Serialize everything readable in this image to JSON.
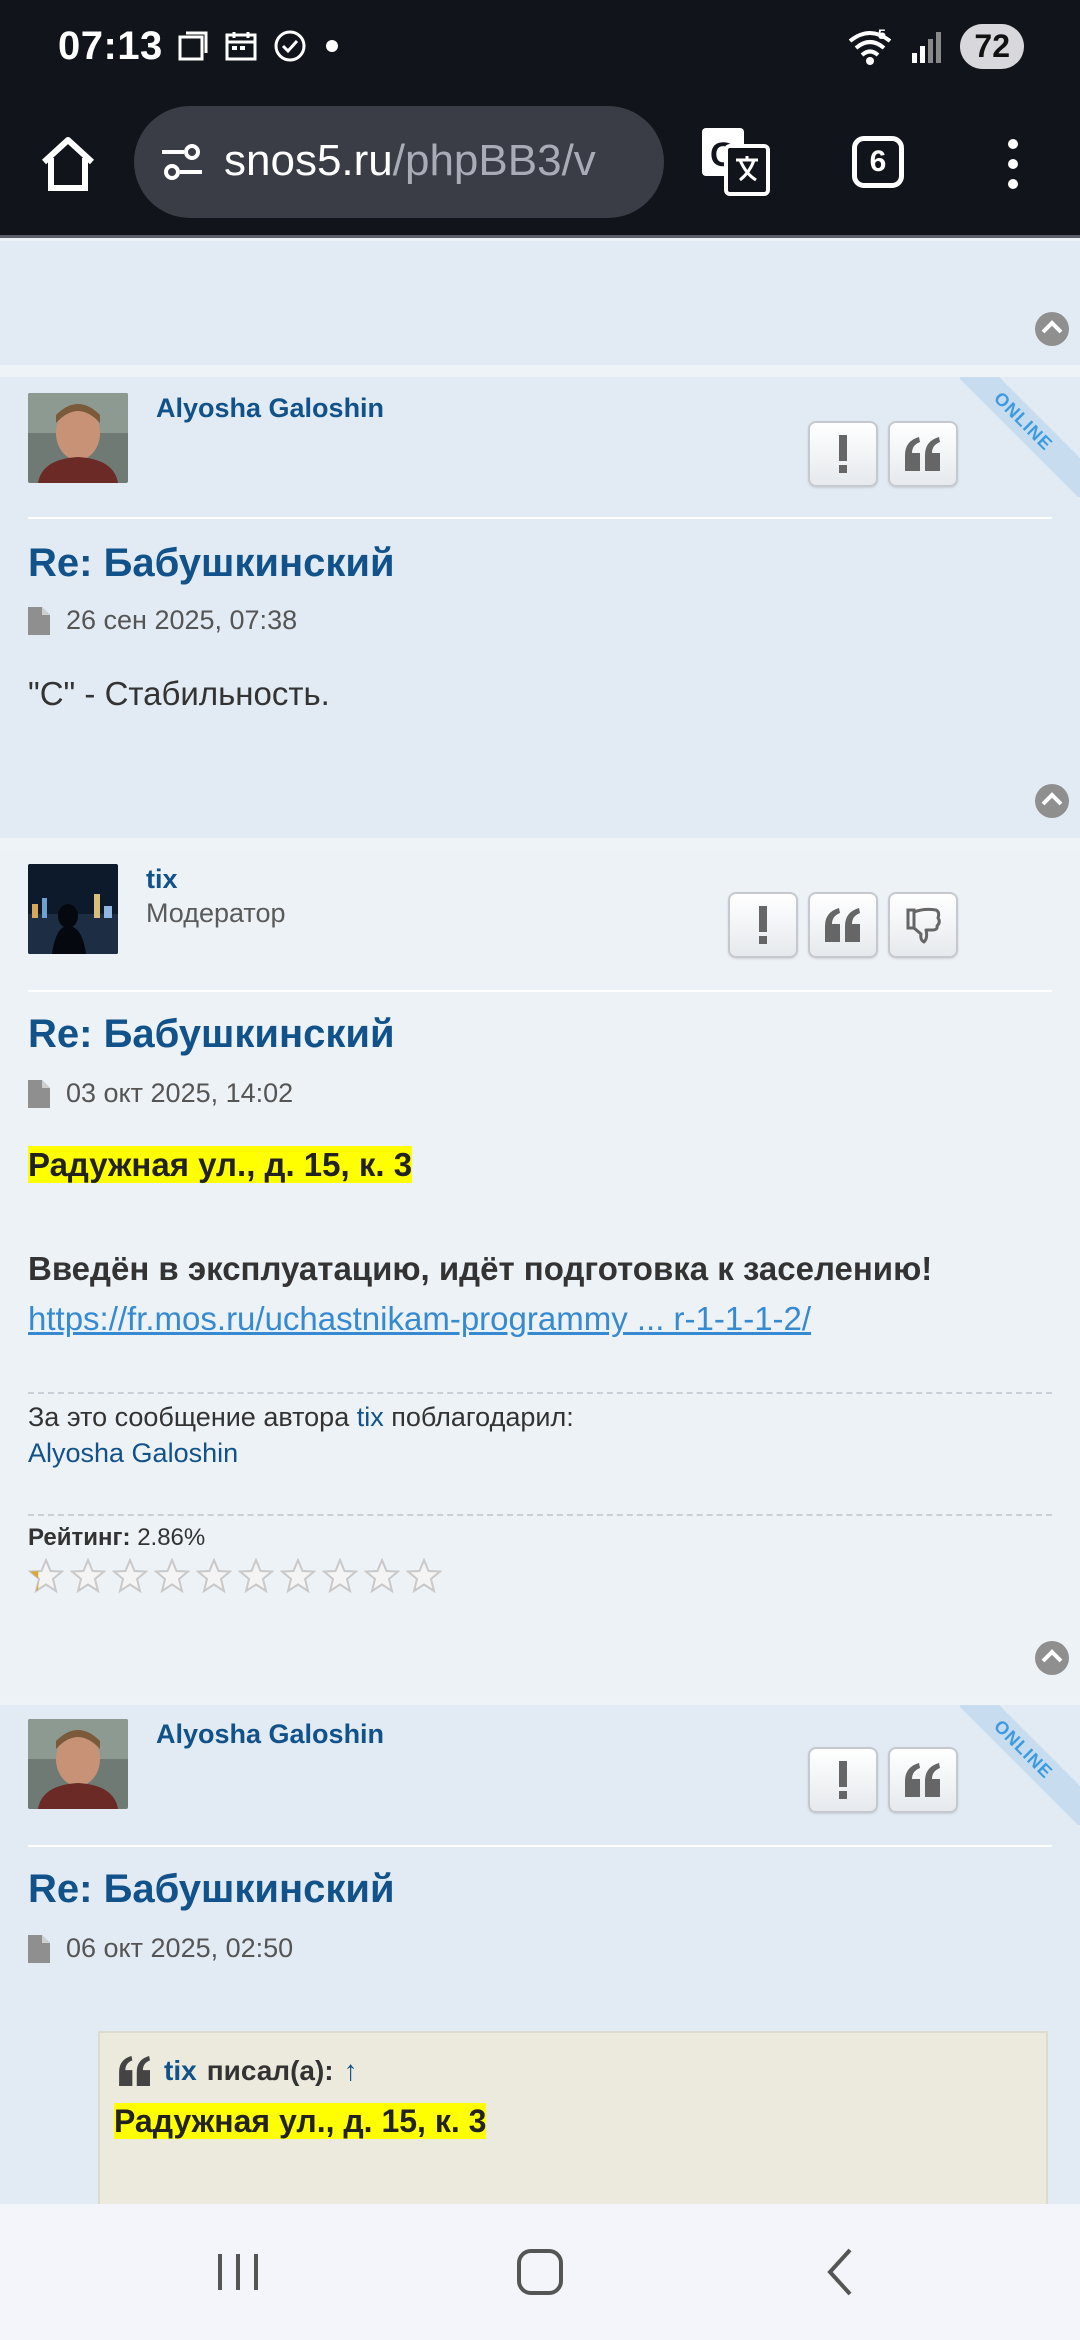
{
  "status_bar": {
    "time": "07:13",
    "wifi_badge": "5",
    "battery": "72"
  },
  "browser": {
    "url_host": "snos5.ru",
    "url_path": "/phpBB3/v",
    "tab_count": "6"
  },
  "posts": [
    {
      "author": "Alyosha Galoshin",
      "online_label": "ONLINE",
      "title": "Re: Бабушкинский",
      "date": "26 сен 2025, 07:38",
      "body": "\"С\" - Стабильность."
    },
    {
      "author": "tix",
      "rank": "Модератор",
      "title": "Re: Бабушкинский",
      "date": "03 окт 2025, 14:02",
      "highlight": "Радужная ул., д. 15, к. 3",
      "body_bold": "Введён в эксплуатацию, идёт подготовка к заселению!",
      "link": "https://fr.mos.ru/uchastnikam-programmy ... r-1-1-1-2/",
      "thanks_prefix": "За это сообщение автора",
      "thanks_author": "tix",
      "thanks_suffix": "поблагодарил:",
      "thanks_user": "Alyosha Galoshin",
      "rating_label": "Рейтинг:",
      "rating_value": "2.86%"
    },
    {
      "author": "Alyosha Galoshin",
      "online_label": "ONLINE",
      "title": "Re: Бабушкинский",
      "date": "06 окт 2025, 02:50",
      "quote_author": "tix",
      "quote_wrote": "писал(а):",
      "quote_arrow": "↑",
      "quote_text": "Радужная ул., д. 15, к. 3"
    }
  ],
  "icons": {
    "home": "home-icon",
    "tune": "tune-icon",
    "translate": "translate-icon",
    "menu": "more-vert-icon",
    "report": "exclamation-icon",
    "quote": "quote-icon",
    "dislike": "thumbs-down-icon",
    "up": "chevron-up-circle-icon",
    "post": "document-icon"
  },
  "rating": {
    "filled_fraction": 0.0286,
    "stars_total": 10
  },
  "colors": {
    "link_blue": "#105289",
    "highlight": "#ffff00",
    "status_bg": "#12141c"
  }
}
